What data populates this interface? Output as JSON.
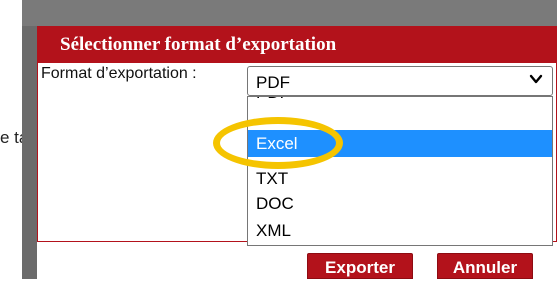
{
  "background": {
    "partial_text": "e ta"
  },
  "dialog": {
    "title": "Sélectionner format d’exportation",
    "format_label": "Format d’exportation :",
    "select": {
      "current_value": "PDF",
      "options": [
        "PDF",
        "Excel",
        "TXT",
        "DOC",
        "XML"
      ],
      "visible_options": [
        {
          "label": "PDF",
          "selected": false,
          "partially_hidden": true
        },
        {
          "label": "Excel",
          "selected": true,
          "partially_hidden": false
        },
        {
          "label": "TXT",
          "selected": false,
          "partially_hidden": true
        },
        {
          "label": "DOC",
          "selected": false,
          "partially_hidden": false
        },
        {
          "label": "XML",
          "selected": false,
          "partially_hidden": false
        }
      ]
    },
    "buttons": {
      "export_label": "Exporter",
      "cancel_label": "Annuler"
    }
  },
  "colors": {
    "title_bar": "#b3121b",
    "button": "#b3121b",
    "selected_option": "#1e90ff",
    "highlight_ring": "#f5c400",
    "overlay": "#6b6b6b"
  },
  "icons": {
    "select_arrow": "chevron-down-icon"
  }
}
